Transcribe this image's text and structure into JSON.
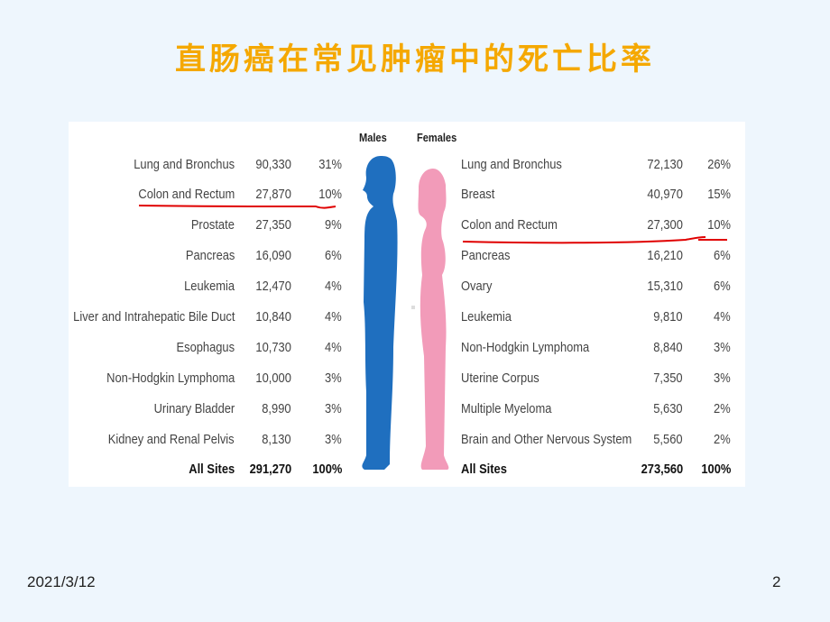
{
  "title": "直肠癌在常见肿瘤中的死亡比率",
  "males": {
    "label": "Males",
    "rows": [
      {
        "site": "Lung and Bronchus",
        "deaths": "90,330",
        "pct": "31%"
      },
      {
        "site": "Colon and Rectum",
        "deaths": "27,870",
        "pct": "10%"
      },
      {
        "site": "Prostate",
        "deaths": "27,350",
        "pct": "9%"
      },
      {
        "site": "Pancreas",
        "deaths": "16,090",
        "pct": "6%"
      },
      {
        "site": "Leukemia",
        "deaths": "12,470",
        "pct": "4%"
      },
      {
        "site": "Liver and Intrahepatic Bile Duct",
        "deaths": "10,840",
        "pct": "4%"
      },
      {
        "site": "Esophagus",
        "deaths": "10,730",
        "pct": "4%"
      },
      {
        "site": "Non-Hodgkin Lymphoma",
        "deaths": "10,000",
        "pct": "3%"
      },
      {
        "site": "Urinary Bladder",
        "deaths": "8,990",
        "pct": "3%"
      },
      {
        "site": "Kidney and Renal Pelvis",
        "deaths": "8,130",
        "pct": "3%"
      }
    ],
    "total": {
      "site": "All Sites",
      "deaths": "291,270",
      "pct": "100%"
    },
    "color": "#1f6fbf"
  },
  "females": {
    "label": "Females",
    "rows": [
      {
        "site": "Lung and Bronchus",
        "deaths": "72,130",
        "pct": "26%"
      },
      {
        "site": "Breast",
        "deaths": "40,970",
        "pct": "15%"
      },
      {
        "site": "Colon and Rectum",
        "deaths": "27,300",
        "pct": "10%"
      },
      {
        "site": "Pancreas",
        "deaths": "16,210",
        "pct": "6%"
      },
      {
        "site": "Ovary",
        "deaths": "15,310",
        "pct": "6%"
      },
      {
        "site": "Leukemia",
        "deaths": "9,810",
        "pct": "4%"
      },
      {
        "site": "Non-Hodgkin Lymphoma",
        "deaths": "8,840",
        "pct": "3%"
      },
      {
        "site": "Uterine Corpus",
        "deaths": "7,350",
        "pct": "3%"
      },
      {
        "site": "Multiple Myeloma",
        "deaths": "5,630",
        "pct": "2%"
      },
      {
        "site": "Brain and Other Nervous System",
        "deaths": "5,560",
        "pct": "2%"
      }
    ],
    "total": {
      "site": "All Sites",
      "deaths": "273,560",
      "pct": "100%"
    },
    "color": "#f29bb9"
  },
  "highlight_color": "#e00000",
  "footer": {
    "date": "2021/3/12",
    "page": "2"
  }
}
